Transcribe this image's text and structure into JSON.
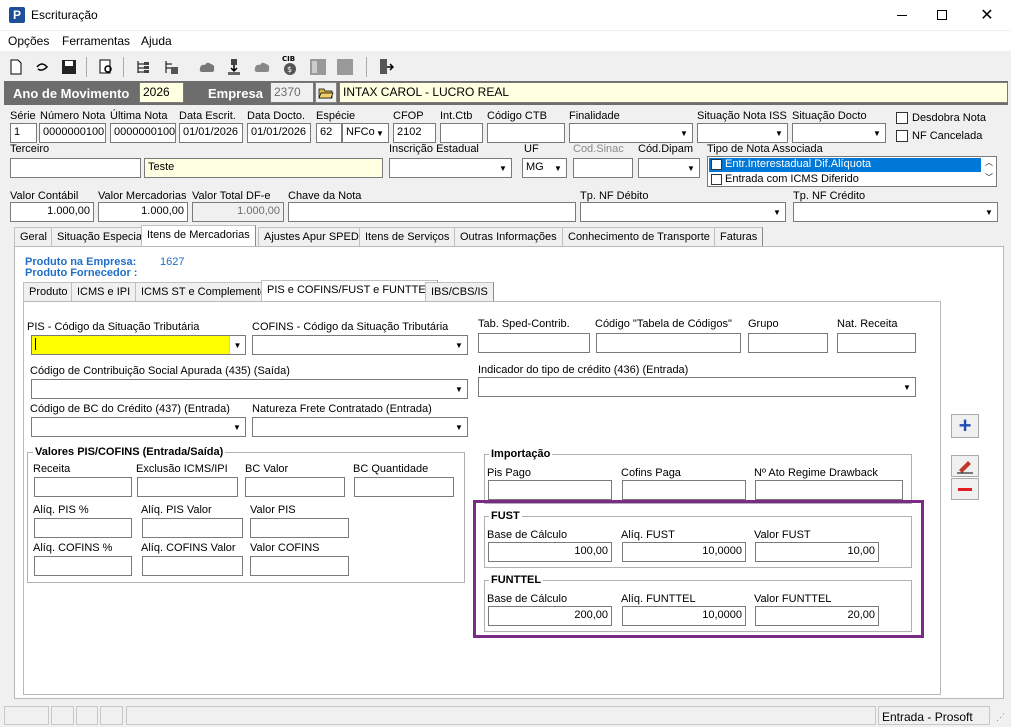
{
  "window": {
    "title": "Escrituração",
    "app_icon": "P"
  },
  "menu": [
    "Opções",
    "Ferramentas",
    "Ajuda"
  ],
  "toolbar": {
    "icons": [
      "new-document-icon",
      "undo-icon",
      "save-icon",
      "print-preview-icon",
      "tree-list-icon",
      "tree-settings-icon",
      "cloud-icon",
      "import-icon",
      "cloud-icon-2",
      "cib-money-icon",
      "panel-icon",
      "panel-icon-2",
      "exit-icon"
    ]
  },
  "header_bar": {
    "ano_label": "Ano de Movimento",
    "ano_value": "2026",
    "empresa_label": "Empresa",
    "empresa_code": "2370",
    "empresa_name": "INTAX CAROL - LUCRO REAL"
  },
  "fields": {
    "serie": {
      "label": "Série",
      "value": "1"
    },
    "numero_nota": {
      "label": "Número Nota",
      "value": "0000000100"
    },
    "ultima_nota": {
      "label": "Última Nota",
      "value": "0000000100"
    },
    "data_escrit": {
      "label": "Data Escrit.",
      "value": "01/01/2026"
    },
    "data_docto": {
      "label": "Data Docto.",
      "value": "01/01/2026"
    },
    "especie": {
      "label": "Espécie",
      "code": "62",
      "value": "NFCo"
    },
    "cfop": {
      "label": "CFOP",
      "value": "2102"
    },
    "int_ctb": {
      "label": "Int.Ctb",
      "value": ""
    },
    "codigo_ctb": {
      "label": "Código CTB",
      "value": ""
    },
    "finalidade": {
      "label": "Finalidade",
      "value": ""
    },
    "situacao_nota_iss": {
      "label": "Situação Nota ISS",
      "value": ""
    },
    "situacao_docto": {
      "label": "Situação Docto",
      "value": ""
    },
    "desdobra_nota": {
      "label": "Desdobra Nota"
    },
    "nf_cancelada": {
      "label": "NF Cancelada"
    },
    "terceiro": {
      "label": "Terceiro",
      "code": "",
      "value": "Teste"
    },
    "inscricao_estadual": {
      "label": "Inscrição Estadual",
      "value": ""
    },
    "uf": {
      "label": "UF",
      "value": "MG"
    },
    "cod_sinac": {
      "label": "Cod.Sinac",
      "value": ""
    },
    "cod_dipam": {
      "label": "Cód.Dipam",
      "value": ""
    },
    "tipo_nota_associada": {
      "label": "Tipo de Nota Associada",
      "items": [
        "Entr.Interestadual Dif.Alíquota",
        "Entrada com ICMS Diferido"
      ]
    },
    "valor_contabil": {
      "label": "Valor Contábil",
      "value": "1.000,00"
    },
    "valor_mercadorias": {
      "label": "Valor Mercadorias",
      "value": "1.000,00"
    },
    "valor_total_dfe": {
      "label": "Valor Total DF-e",
      "value": "1.000,00"
    },
    "chave_nota": {
      "label": "Chave da Nota",
      "value": ""
    },
    "tp_nf_debito": {
      "label": "Tp. NF Débito",
      "value": ""
    },
    "tp_nf_credito": {
      "label": "Tp. NF Crédito",
      "value": ""
    }
  },
  "main_tabs": [
    "Geral",
    "Situação Especial",
    "Itens de Mercadorias",
    "Ajustes Apur SPED",
    "Itens de Serviços",
    "Outras Informações",
    "Conhecimento de Transporte",
    "Faturas"
  ],
  "produto": {
    "empresa_label": "Produto na Empresa:",
    "empresa_value": "1627",
    "fornecedor_label": "Produto Fornecedor :"
  },
  "sub_tabs": [
    "Produto",
    "ICMS e IPI",
    "ICMS ST e Complemento",
    "PIS e COFINS/FUST e FUNTTEL",
    "IBS/CBS/IS"
  ],
  "pis_cofins": {
    "pis_cst_label": "PIS - Código da Situação Tributária",
    "cofins_cst_label": "COFINS - Código da Situação Tributária",
    "tab_sped_label": "Tab. Sped-Contrib.",
    "codigo_tabela_label": "Código \"Tabela de Códigos\"",
    "grupo_label": "Grupo",
    "nat_receita_label": "Nat. Receita",
    "contrib_social_label": "Código de Contribuição Social Apurada (435)     (Saída)",
    "indicador_credito_label": "Indicador do tipo de crédito (436)     (Entrada)",
    "bc_credito_label": "Código de BC do Crédito (437) (Entrada)",
    "natureza_frete_label": "Natureza Frete Contratado   (Entrada)"
  },
  "valores_group": {
    "title": "Valores PIS/COFINS (Entrada/Saída)",
    "receita": "Receita",
    "exclusao": "Exclusão ICMS/IPI",
    "bc_valor": "BC Valor",
    "bc_quantidade": "BC Quantidade",
    "aliq_pis_pct": "Alíq. PIS %",
    "aliq_pis_valor": "Alíq. PIS Valor",
    "valor_pis": "Valor PIS",
    "aliq_cofins_pct": "Alíq. COFINS %",
    "aliq_cofins_valor": "Alíq. COFINS Valor",
    "valor_cofins": "Valor COFINS"
  },
  "importacao_group": {
    "title": "Importação",
    "pis_pago": "Pis Pago",
    "cofins_paga": "Cofins Paga",
    "ato_drawback": "Nº Ato Regime Drawback"
  },
  "fust_group": {
    "title": "FUST",
    "base_label": "Base de Cálculo",
    "base_value": "100,00",
    "aliq_label": "Alíq. FUST",
    "aliq_value": "10,0000",
    "valor_label": "Valor FUST",
    "valor_value": "10,00"
  },
  "funttel_group": {
    "title": "FUNTTEL",
    "base_label": "Base de Cálculo",
    "base_value": "200,00",
    "aliq_label": "Alíq. FUNTTEL",
    "aliq_value": "10,0000",
    "valor_label": "Valor FUNTTEL",
    "valor_value": "20,00"
  },
  "status_bar": {
    "right_text": "Entrada - Prosoft"
  },
  "colors": {
    "highlight_yellow": "#ffff00",
    "field_yellow": "#ffffe1",
    "header_dark": "#6d6d6d",
    "link_blue": "#1f6fc9",
    "purple_box": "#7b2a86",
    "selection_blue": "#0078d7"
  }
}
